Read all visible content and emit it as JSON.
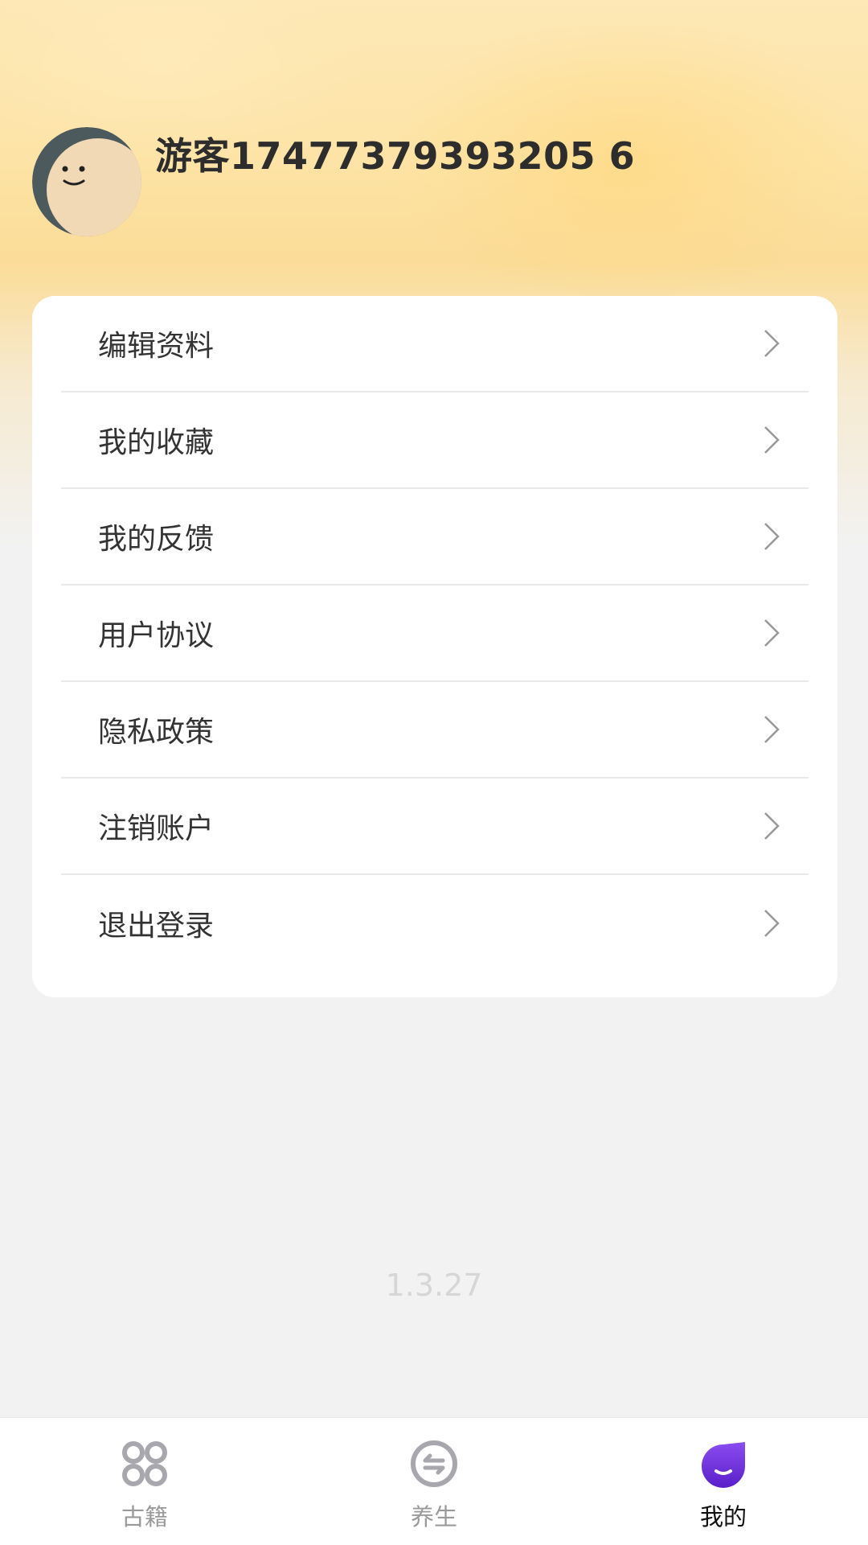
{
  "profile": {
    "username": "游客17477379393205 6"
  },
  "menu": {
    "items": [
      {
        "label": "编辑资料",
        "name": "edit-profile"
      },
      {
        "label": "我的收藏",
        "name": "my-favorites"
      },
      {
        "label": "我的反馈",
        "name": "my-feedback"
      },
      {
        "label": "用户协议",
        "name": "user-agreement"
      },
      {
        "label": "隐私政策",
        "name": "privacy-policy"
      },
      {
        "label": "注销账户",
        "name": "delete-account"
      },
      {
        "label": "退出登录",
        "name": "logout"
      }
    ]
  },
  "version": "1.3.27",
  "tabs": [
    {
      "label": "古籍",
      "icon": "grid-four-circles-icon",
      "active": false
    },
    {
      "label": "养生",
      "icon": "exchange-circle-icon",
      "active": false
    },
    {
      "label": "我的",
      "icon": "smile-drop-icon",
      "active": true
    }
  ],
  "colors": {
    "accent": "#6a2bd9",
    "inactive_tab": "#9a9a9a",
    "header_gold": "#fbdc98"
  }
}
